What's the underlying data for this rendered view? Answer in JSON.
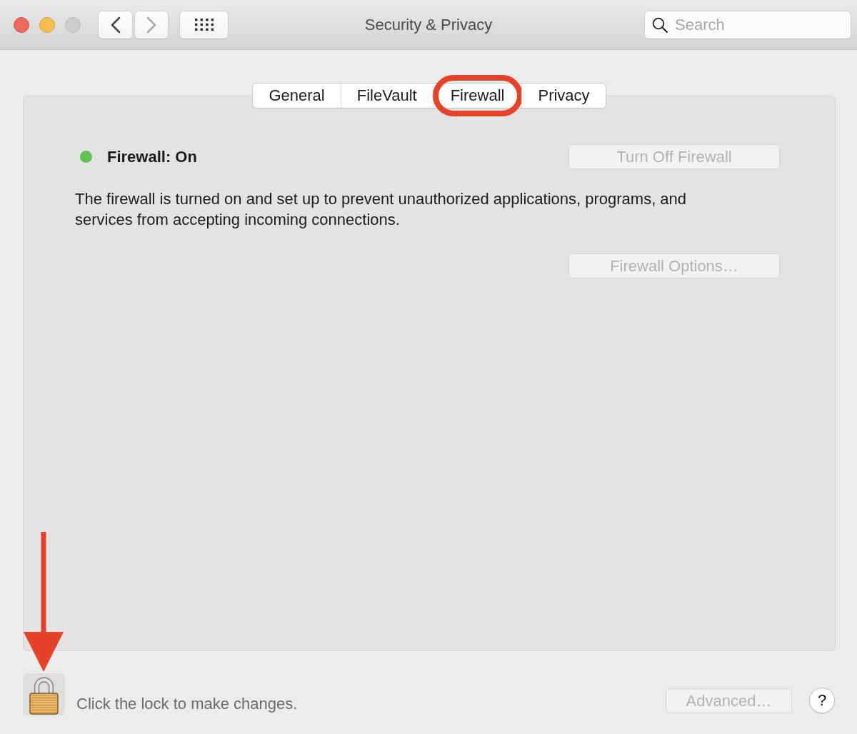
{
  "window": {
    "title": "Security & Privacy",
    "controls": [
      {
        "kind": "close",
        "disabled": false
      },
      {
        "kind": "minimize",
        "disabled": false
      },
      {
        "kind": "zoom",
        "disabled": true
      }
    ]
  },
  "toolbar": {
    "nav": [
      {
        "kind": "back",
        "disabled": false
      },
      {
        "kind": "forward",
        "disabled": true
      }
    ],
    "search": {
      "placeholder": "Search"
    }
  },
  "tabs": [
    {
      "label": "General",
      "circled": false
    },
    {
      "label": "FileVault",
      "circled": false
    },
    {
      "label": "Firewall",
      "circled": true
    },
    {
      "label": "Privacy",
      "circled": false
    }
  ],
  "firewall": {
    "status": "Firewall: On",
    "on": true,
    "toggle_button": {
      "label": "Turn Off Firewall",
      "disabled": true
    },
    "description": "The firewall is turned on and set up to prevent unauthorized applications, programs, and services from accepting incoming connections.",
    "options_button": {
      "label": "Firewall Options…",
      "disabled": true
    }
  },
  "footer": {
    "lock": {
      "locked": true,
      "pointed_at": true
    },
    "lock_hint": "Click the lock to make changes.",
    "advanced_button": {
      "label": "Advanced…",
      "disabled": true
    },
    "help_button": {
      "label": "?"
    }
  }
}
